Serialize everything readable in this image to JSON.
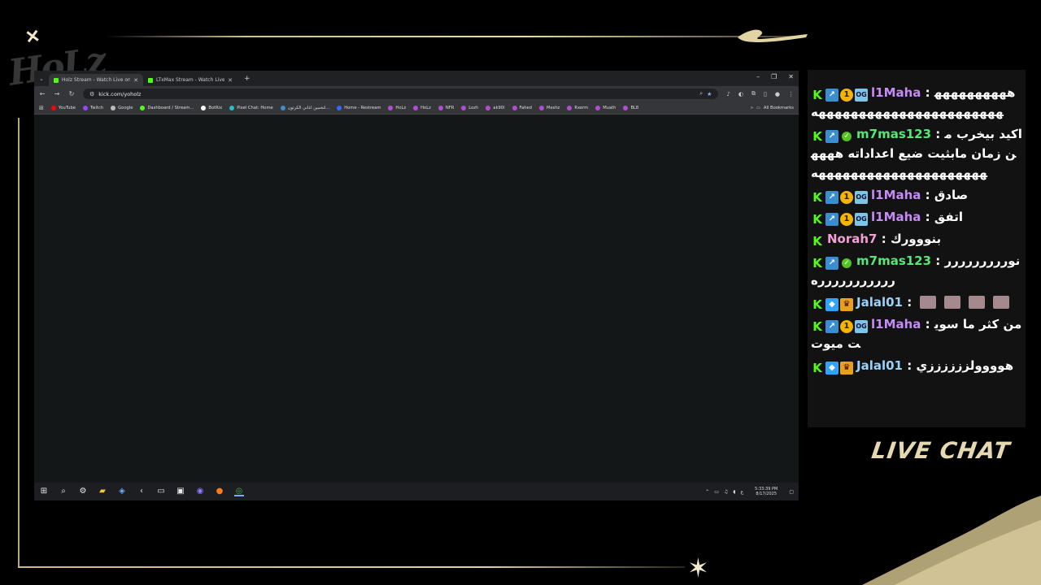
{
  "browser": {
    "tab_list_icon": "chevron-down-icon",
    "tabs": [
      {
        "title": "Holz Stream - Watch Live on",
        "active": true
      },
      {
        "title": "LTxMax Stream - Watch Live on",
        "active": false
      }
    ],
    "new_tab_glyph": "+",
    "window_controls": [
      "–",
      "❐",
      "✕"
    ],
    "url": "kick.com/yoholz",
    "bookmarks": [
      {
        "label": "YouTube",
        "color": "#ff0000"
      },
      {
        "label": "Twitch",
        "color": "#9146ff"
      },
      {
        "label": "Google",
        "color": "#bbbbbb"
      },
      {
        "label": "Dashboard / Stream...",
        "color": "#53fc18"
      },
      {
        "label": "BotRix",
        "color": "#ffffff"
      },
      {
        "label": "Pixel Chat: Home",
        "color": "#20c4c4"
      },
      {
        "label": "لتخمين اغاني الكرتون...",
        "color": "#3a8ecf"
      },
      {
        "label": "Home - Restream",
        "color": "#2f6bff"
      },
      {
        "label": "HoLz",
        "color": "#b44bd6"
      },
      {
        "label": "HoLz",
        "color": "#b44bd6"
      },
      {
        "label": "NFR",
        "color": "#b44bd6"
      },
      {
        "label": "Lozh",
        "color": "#b44bd6"
      },
      {
        "label": "ak90l",
        "color": "#b44bd6"
      },
      {
        "label": "Fahed",
        "color": "#b44bd6"
      },
      {
        "label": "Meshz",
        "color": "#b44bd6"
      },
      {
        "label": "Rxerm",
        "color": "#b44bd6"
      },
      {
        "label": "Muath",
        "color": "#b44bd6"
      },
      {
        "label": "BL8",
        "color": "#b44bd6"
      }
    ],
    "all_bookmarks_label": "All Bookmarks",
    "taskbar": {
      "time": "5:33:39 PM",
      "date": "8/17/2025",
      "lang": "ع"
    }
  },
  "chat": {
    "messages": [
      {
        "badges": [
          "kick",
          "vip",
          "gift",
          "og"
        ],
        "user": "l1Maha",
        "user_color": "#c58cf5",
        "sep": " : ",
        "text": "هههههههههههههههههههههههههههههههههه"
      },
      {
        "badges": [
          "kick",
          "vip",
          "verified"
        ],
        "user": "m7mas123",
        "user_color": "#55e878",
        "sep": " : ",
        "text": "اكيد بيخرب من زمان مابثيت ضيع اعداداته هههههههههههههههههههههههههه"
      },
      {
        "badges": [
          "kick",
          "vip",
          "gift",
          "og"
        ],
        "user": "l1Maha",
        "user_color": "#c58cf5",
        "sep": " : ",
        "text": "صادق"
      },
      {
        "badges": [
          "kick",
          "vip",
          "gift",
          "og"
        ],
        "user": "l1Maha",
        "user_color": "#c58cf5",
        "sep": " : ",
        "text": "اتفق"
      },
      {
        "badges": [
          "kick"
        ],
        "user": "Norah7",
        "user_color": "#f2a0d4",
        "sep": " : ",
        "text": "بنووورك"
      },
      {
        "badges": [
          "kick",
          "vip",
          "verified"
        ],
        "user": "m7mas123",
        "user_color": "#55e878",
        "sep": " : ",
        "text": "نورررررررررررررررررررره"
      },
      {
        "badges": [
          "kick",
          "box",
          "crown"
        ],
        "user": "Jalal01",
        "user_color": "#9ad2f7",
        "sep": " : ",
        "text": "",
        "emotes": 4
      },
      {
        "badges": [
          "kick",
          "vip",
          "gift",
          "og"
        ],
        "user": "l1Maha",
        "user_color": "#c58cf5",
        "sep": " : ",
        "text": "من كثر ما سويت ميوت"
      },
      {
        "badges": [
          "kick",
          "box",
          "crown"
        ],
        "user": "Jalal01",
        "user_color": "#9ad2f7",
        "sep": " : ",
        "text": "هوووولززززززي"
      }
    ]
  },
  "overlay": {
    "live_chat_label": "LIVE CHAT",
    "logo_text": "HoLz",
    "accent": "#e4d9b0"
  }
}
